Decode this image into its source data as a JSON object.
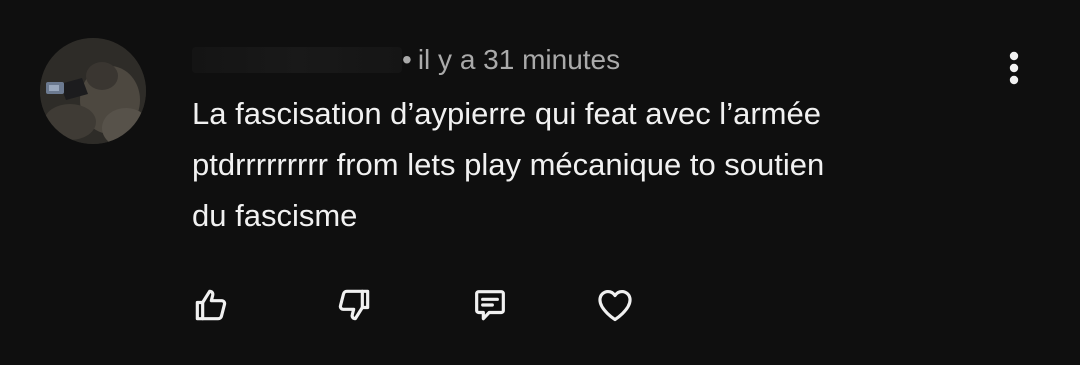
{
  "comment": {
    "author": "",
    "timestamp": "il y a 31 minutes",
    "separator": "•",
    "text_lines": [
      "La fascisation d’aypierre qui feat avec l’armée",
      "ptdrrrrrrrrr from lets play mécanique to soutien",
      "du fascisme"
    ]
  },
  "icons": {
    "menu": "more-vertical-icon",
    "like": "thumbs-up-icon",
    "dislike": "thumbs-down-icon",
    "reply": "reply-comment-icon",
    "heart": "heart-icon"
  },
  "colors": {
    "background": "#0f0f0f",
    "text": "#f1f1f1",
    "meta": "#aaaaaa"
  }
}
